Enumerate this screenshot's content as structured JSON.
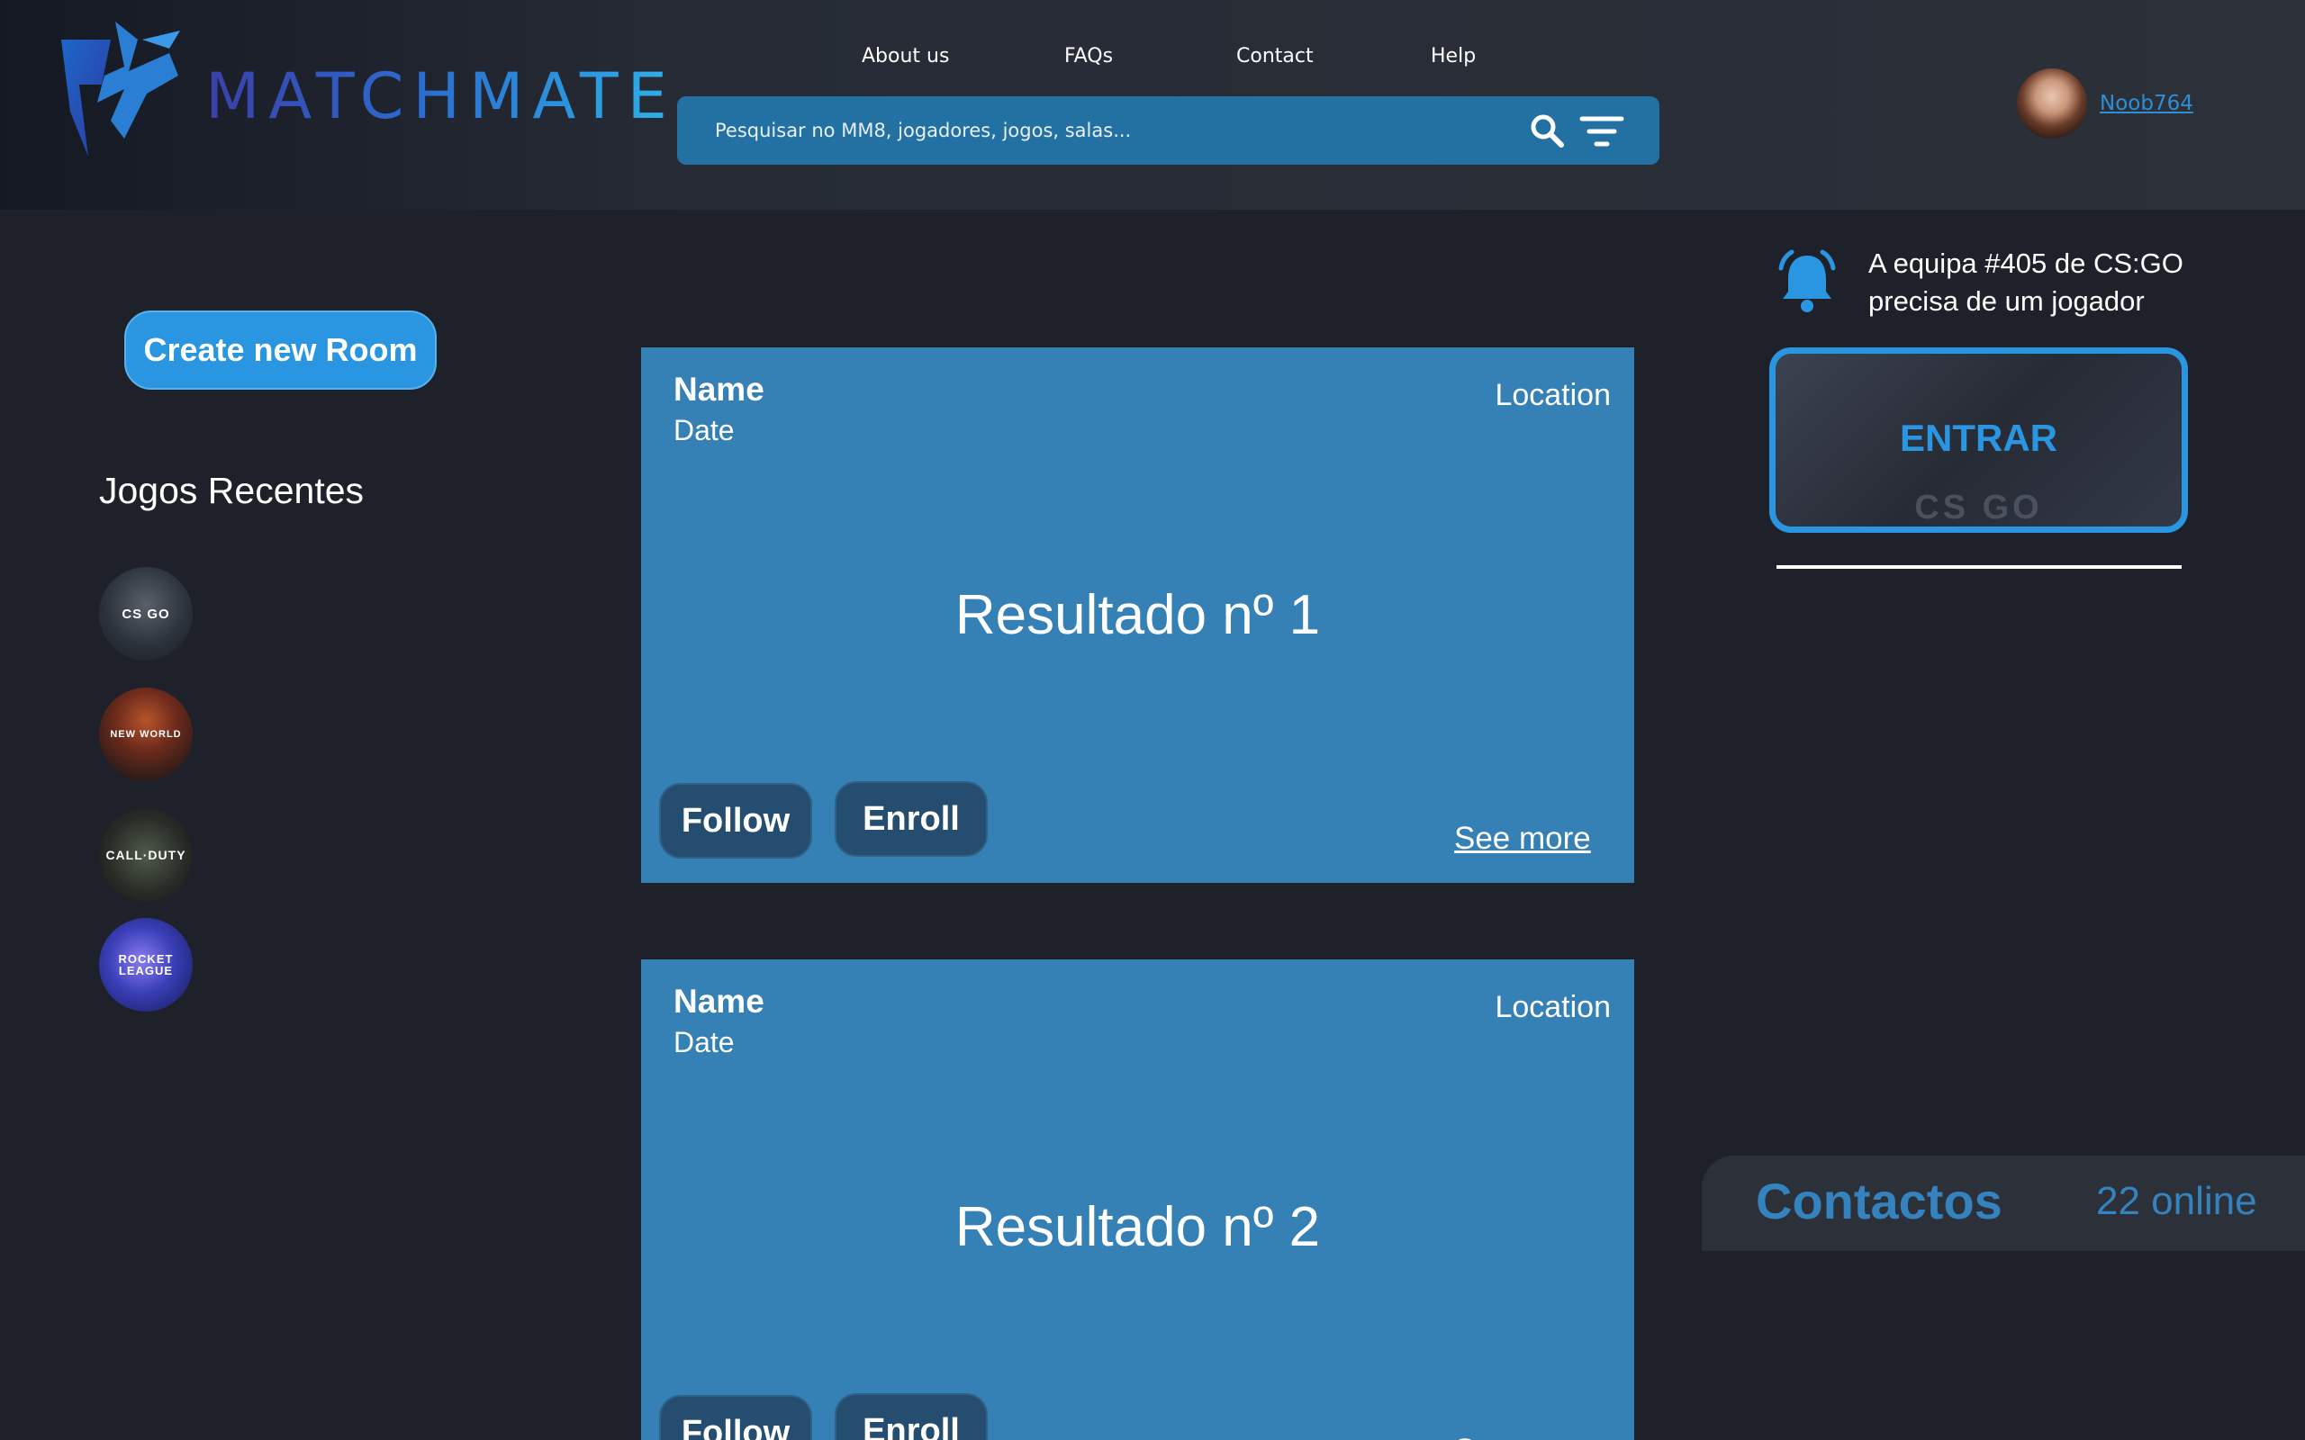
{
  "header": {
    "logo_text": "MATCHMATE",
    "nav": [
      "About us",
      "FAQs",
      "Contact",
      "Help"
    ],
    "search_placeholder": "Pesquisar no MM8, jogadores, jogos, salas...",
    "username": "Noob764"
  },
  "sidebar": {
    "create_room_label": "Create new Room",
    "recent_games_title": "Jogos Recentes",
    "games": [
      {
        "name": "CS:GO",
        "label": "CS GO"
      },
      {
        "name": "New World",
        "label": "NEW WORLD"
      },
      {
        "name": "Call of Duty Black Ops",
        "label": "CALL·DUTY"
      },
      {
        "name": "Rocket League",
        "label": "ROCKET LEAGUE"
      }
    ]
  },
  "results": [
    {
      "name": "Name",
      "date": "Date",
      "location": "Location",
      "title": "Resultado nº 1",
      "follow": "Follow",
      "enroll": "Enroll",
      "see_more": "See more"
    },
    {
      "name": "Name",
      "date": "Date",
      "location": "Location",
      "title": "Resultado nº 2",
      "follow": "Follow",
      "enroll": "Enroll",
      "see_more": "See more"
    }
  ],
  "notification": {
    "text": "A equipa #405 de CS:GO precisa de um jogador",
    "button_label": "ENTRAR",
    "watermark": "CS GO"
  },
  "contacts": {
    "title": "Contactos",
    "online": "22 online"
  },
  "colors": {
    "background": "#1e2129",
    "accent": "#2a95e1",
    "card": "#3580b5",
    "search": "#2370a3"
  }
}
